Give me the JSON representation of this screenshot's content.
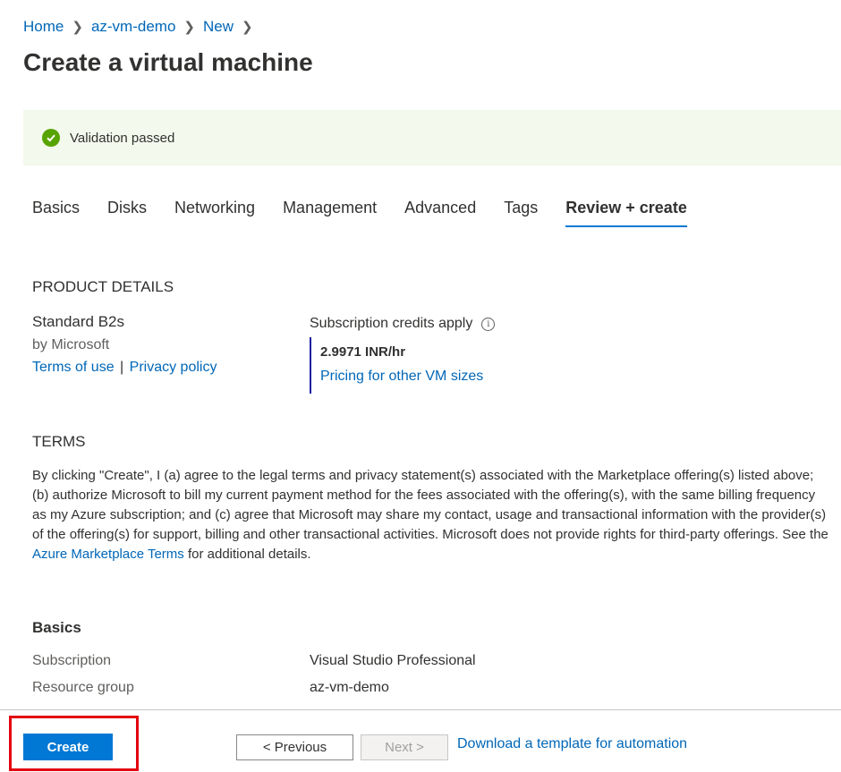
{
  "breadcrumb": [
    "Home",
    "az-vm-demo",
    "New"
  ],
  "title": "Create a virtual machine",
  "validation": {
    "text": "Validation passed",
    "color": "#57a300"
  },
  "tabs": [
    {
      "label": "Basics"
    },
    {
      "label": "Disks"
    },
    {
      "label": "Networking"
    },
    {
      "label": "Management"
    },
    {
      "label": "Advanced"
    },
    {
      "label": "Tags"
    },
    {
      "label": "Review + create",
      "active": true
    }
  ],
  "product": {
    "heading": "PRODUCT DETAILS",
    "name": "Standard B2s",
    "publisher": "by Microsoft",
    "terms_link": "Terms of use",
    "separator": "|",
    "privacy_link": "Privacy policy",
    "credits_label": "Subscription credits apply",
    "info_icon": "info-icon",
    "price": "2.9971 INR/hr",
    "pricing_link": "Pricing for other VM sizes"
  },
  "terms": {
    "heading": "TERMS",
    "text_before": "By clicking \"Create\", I (a) agree to the legal terms and privacy statement(s) associated with the Marketplace offering(s) listed above; (b) authorize Microsoft to bill my current payment method for the fees associated with the offering(s), with the same billing frequency as my Azure subscription; and (c) agree that Microsoft may share my contact, usage and transactional information with the provider(s) of the offering(s) for support, billing and other transactional activities. Microsoft does not provide rights for third-party offerings. See the ",
    "link": "Azure Marketplace Terms",
    "text_after": " for additional details."
  },
  "basics": {
    "heading": "Basics",
    "rows": [
      {
        "key": "Subscription",
        "value": "Visual Studio Professional"
      },
      {
        "key": "Resource group",
        "value": "az-vm-demo"
      }
    ]
  },
  "footer": {
    "create": "Create",
    "previous": "< Previous",
    "next": "Next >",
    "download": "Download a template for automation"
  },
  "colors": {
    "accent": "#0078d4",
    "link": "#0067b8",
    "highlight": "#e3000f",
    "validation_bg": "#f3f9ec"
  }
}
